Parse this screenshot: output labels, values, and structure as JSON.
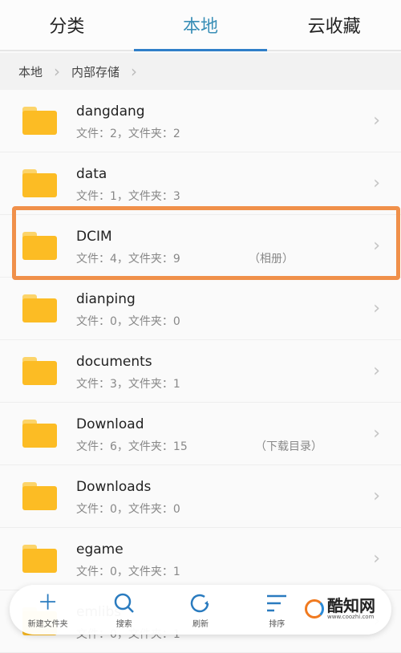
{
  "tabs": [
    {
      "label": "分类"
    },
    {
      "label": "本地",
      "active": true
    },
    {
      "label": "云收藏"
    }
  ],
  "breadcrumb": [
    "本地",
    "内部存储"
  ],
  "folders": [
    {
      "name": "dangdang",
      "meta": "文件：2，文件夹：2",
      "note": ""
    },
    {
      "name": "data",
      "meta": "文件：1，文件夹：3",
      "note": ""
    },
    {
      "name": "DCIM",
      "meta": "文件：4，文件夹：9",
      "note": "（相册）"
    },
    {
      "name": "dianping",
      "meta": "文件：0，文件夹：0",
      "note": ""
    },
    {
      "name": "documents",
      "meta": "文件：3，文件夹：1",
      "note": ""
    },
    {
      "name": "Download",
      "meta": "文件：6，文件夹：15",
      "note": "（下载目录）"
    },
    {
      "name": "Downloads",
      "meta": "文件：0，文件夹：0",
      "note": ""
    },
    {
      "name": "egame",
      "meta": "文件：0，文件夹：1",
      "note": ""
    },
    {
      "name": "emlibs",
      "meta": "文件：0，文件夹：1",
      "note": ""
    }
  ],
  "toolbar": {
    "new_folder": "新建文件夹",
    "search": "搜索",
    "refresh": "刷新",
    "sort": "排序"
  },
  "watermark": {
    "name": "酷知网",
    "url": "www.coozhi.com"
  },
  "colors": {
    "accent": "#2f7fc9",
    "highlight": "#f0904a",
    "folder": "#fcbc24"
  }
}
